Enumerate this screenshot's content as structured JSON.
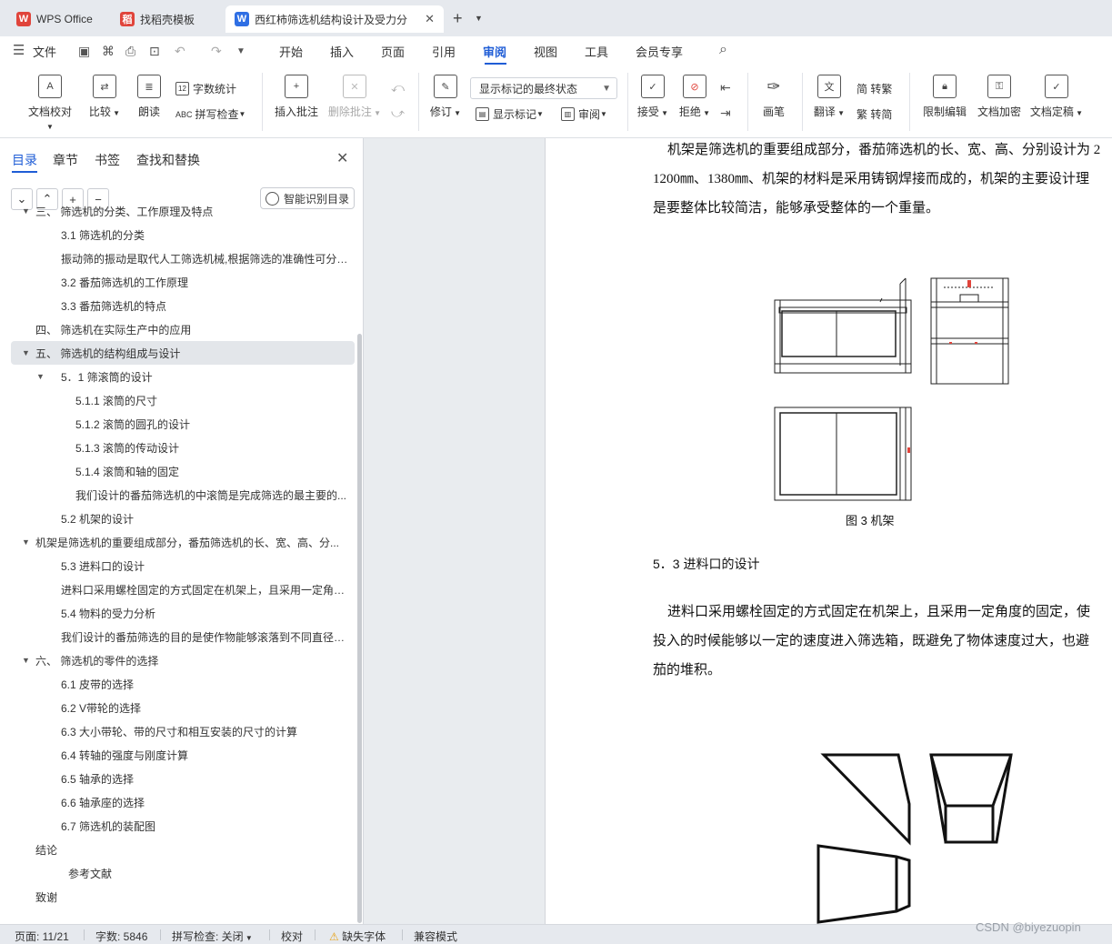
{
  "tabs": [
    {
      "label": "WPS Office",
      "logo": "W"
    },
    {
      "label": "找稻壳模板",
      "logo": "稻"
    },
    {
      "label": "西红柿筛选机结构设计及受力分",
      "logo": "W"
    }
  ],
  "menu": {
    "file": "文件",
    "items": [
      "开始",
      "插入",
      "页面",
      "引用",
      "审阅",
      "视图",
      "工具",
      "会员专享"
    ],
    "active": "审阅"
  },
  "ribbon": {
    "doc_check": "文档校对",
    "compare": "比较",
    "read_aloud": "朗读",
    "word_count": "字数统计",
    "spell_check": "拼写检查",
    "insert_comment": "插入批注",
    "delete_comment": "删除批注",
    "revise": "修订",
    "markup_select": "显示标记的最终状态",
    "show_markup": "显示标记",
    "review": "审阅",
    "accept": "接受",
    "reject": "拒绝",
    "pen": "画笔",
    "translate": "翻译",
    "to_traditional": "简 转繁",
    "to_simplified": "繁 转简",
    "restrict_edit": "限制编辑",
    "encrypt": "文档加密",
    "finalize": "文档定稿"
  },
  "panel": {
    "tabs": [
      "目录",
      "章节",
      "书签",
      "查找和替换"
    ],
    "smart_toc": "智能识别目录",
    "toc": [
      {
        "text": "三、    筛选机的分类、工作原理及特点",
        "level": 0,
        "arrow": "▼"
      },
      {
        "text": "3.1    筛选机的分类",
        "level": 1,
        "arrow": ""
      },
      {
        "text": "振动筛的振动是取代人工筛选机械,根据筛选的准确性可分为...",
        "level": 1,
        "arrow": ""
      },
      {
        "text": "3.2    番茄筛选机的工作原理",
        "level": 1,
        "arrow": ""
      },
      {
        "text": "3.3    番茄筛选机的特点",
        "level": 1,
        "arrow": ""
      },
      {
        "text": "四、    筛选机在实际生产中的应用",
        "level": 0,
        "arrow": ""
      },
      {
        "text": "五、    筛选机的结构组成与设计",
        "level": 0,
        "arrow": "▼"
      },
      {
        "text": "5．1    筛滚筒的设计",
        "level": 1,
        "arrow": "▼"
      },
      {
        "text": "5.1.1    滚筒的尺寸",
        "level": 2,
        "arrow": ""
      },
      {
        "text": "5.1.2    滚筒的圆孔的设计",
        "level": 2,
        "arrow": ""
      },
      {
        "text": "5.1.3    滚筒的传动设计",
        "level": 2,
        "arrow": ""
      },
      {
        "text": "5.1.4    滚筒和轴的固定",
        "level": 2,
        "arrow": ""
      },
      {
        "text": "我们设计的番茄筛选机的中滚筒是完成筛选的最主要的...",
        "level": 2,
        "arrow": ""
      },
      {
        "text": "5.2    机架的设计",
        "level": 1,
        "arrow": ""
      },
      {
        "text": "机架是筛选机的重要组成部分，番茄筛选机的长、宽、高、分...",
        "level": 0,
        "arrow": "▼"
      },
      {
        "text": "5.3    进料口的设计",
        "level": 1,
        "arrow": ""
      },
      {
        "text": "进料口采用螺栓固定的方式固定在机架上，且采用一定角度...",
        "level": 1,
        "arrow": ""
      },
      {
        "text": "5.4    物料的受力分析",
        "level": 1,
        "arrow": ""
      },
      {
        "text": "我们设计的番茄筛选的目的是使作物能够滚落到不同直径的...",
        "level": 1,
        "arrow": ""
      },
      {
        "text": "六、    筛选机的零件的选择",
        "level": 0,
        "arrow": "▼"
      },
      {
        "text": "6.1    皮带的选择",
        "level": 1,
        "arrow": ""
      },
      {
        "text": "6.2    V带轮的选择",
        "level": 1,
        "arrow": ""
      },
      {
        "text": "6.3    大小带轮、带的尺寸和相互安装的尺寸的计算",
        "level": 1,
        "arrow": ""
      },
      {
        "text": "6.4    转轴的强度与刚度计算",
        "level": 1,
        "arrow": ""
      },
      {
        "text": "6.5    轴承的选择",
        "level": 1,
        "arrow": ""
      },
      {
        "text": "6.6    轴承座的选择",
        "level": 1,
        "arrow": ""
      },
      {
        "text": "6.7    筛选机的装配图",
        "level": 1,
        "arrow": ""
      },
      {
        "text": "结论",
        "level": 0,
        "arrow": ""
      },
      {
        "text": "参考文献",
        "level": 3,
        "arrow": ""
      },
      {
        "text": "致谢",
        "level": 0,
        "arrow": ""
      }
    ]
  },
  "document": {
    "para1": [
      "机架是筛选机的重要组成部分，番茄筛选机的长、宽、高、分别设计为 2",
      "1200㎜、1380㎜、机架的材料是采用铸钢焊接而成的，机架的主要设计理",
      "是要整体比较简洁，能够承受整体的一个重量。"
    ],
    "figure_caption": "图 3  机架",
    "heading_53": "5．3    进料口的设计",
    "para2": [
      "进料口采用螺栓固定的方式固定在机架上，且采用一定角度的固定，使",
      "投入的时候能够以一定的速度进入筛选箱，既避免了物体速度过大，也避",
      "茄的堆积。"
    ]
  },
  "statusbar": {
    "page": "页面: 11/21",
    "words": "字数: 5846",
    "spell": "拼写检查: 关闭",
    "proof": "校对",
    "missing_font": "缺失字体",
    "compat": "兼容模式"
  },
  "watermark": "CSDN @biyezuopin",
  "colors": {
    "accent": "#1f5dd6",
    "wps_red": "#e0443b"
  }
}
